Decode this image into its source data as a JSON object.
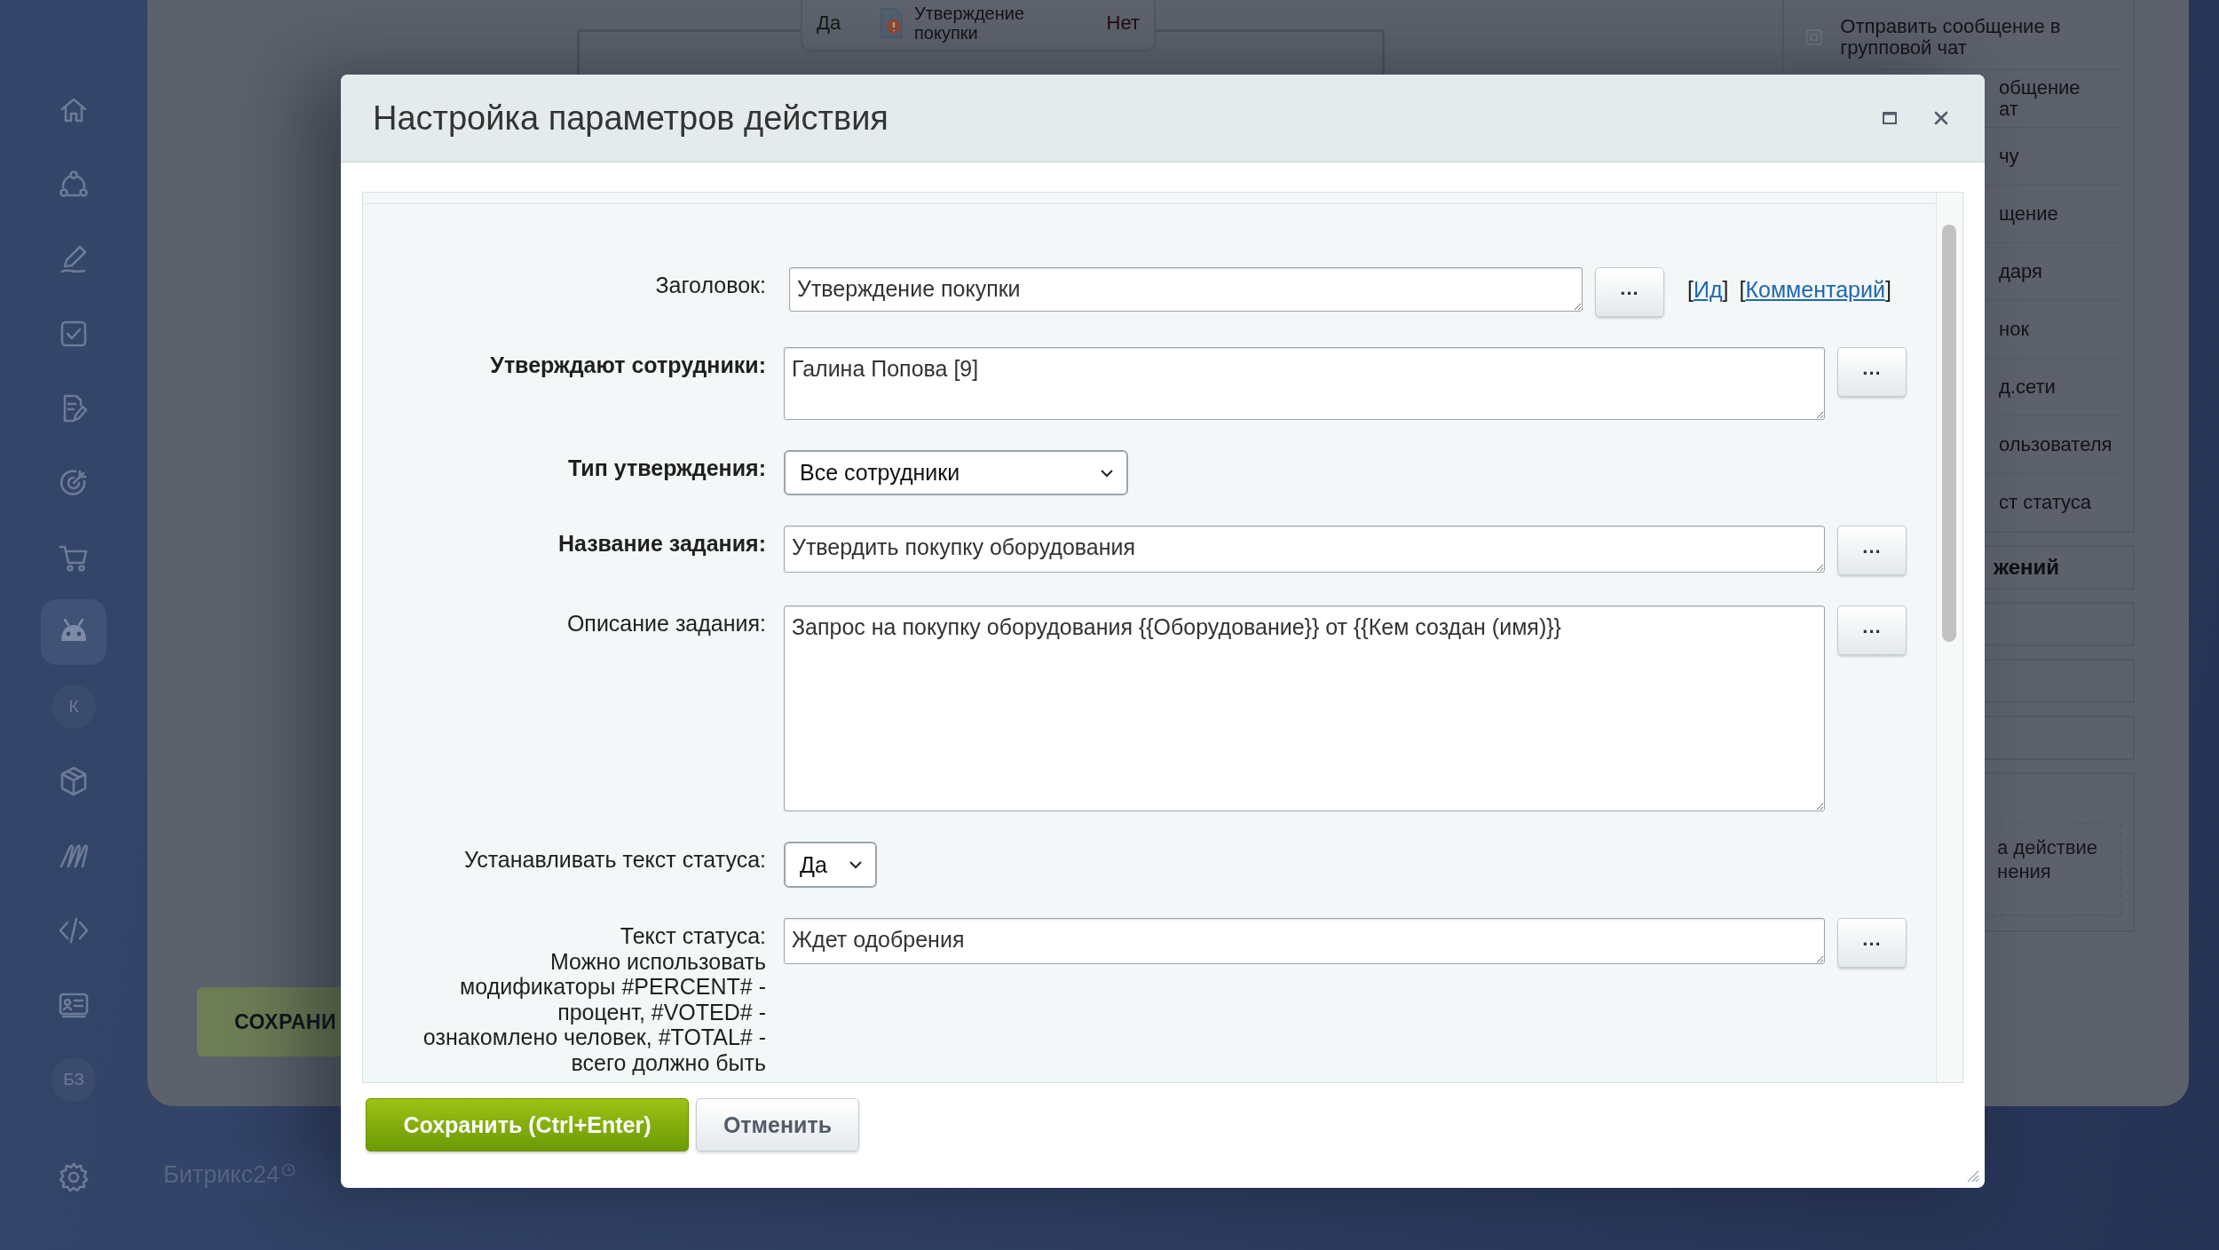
{
  "sidebar": {
    "items": [
      {
        "kind": "icon",
        "selected": false
      },
      {
        "kind": "icon",
        "selected": false
      },
      {
        "kind": "icon",
        "selected": false
      },
      {
        "kind": "icon",
        "selected": false
      },
      {
        "kind": "icon",
        "selected": false
      },
      {
        "kind": "icon",
        "selected": false
      },
      {
        "kind": "icon",
        "selected": false
      },
      {
        "kind": "icon",
        "selected": true
      },
      {
        "kind": "avatar",
        "label": "К",
        "selected": false
      },
      {
        "kind": "icon",
        "selected": false
      },
      {
        "kind": "icon",
        "selected": false
      },
      {
        "kind": "icon",
        "selected": false
      },
      {
        "kind": "icon",
        "selected": false
      },
      {
        "kind": "avatar",
        "label": "БЗ",
        "selected": false
      },
      {
        "kind": "icon",
        "selected": false
      }
    ]
  },
  "background": {
    "diagram": {
      "yes_label": "Да",
      "title": "Утверждение покупки",
      "no_label": "Нет"
    },
    "actions_panel": {
      "items": [
        {
          "kind": "action",
          "label": "Отправить сообщение в групповой чат"
        },
        {
          "kind": "fragment",
          "label": "общение\nат"
        },
        {
          "kind": "fragment",
          "label": "чу"
        },
        {
          "kind": "fragment",
          "label": "щение"
        },
        {
          "kind": "fragment",
          "label": "даря"
        },
        {
          "kind": "fragment",
          "label": "нок"
        },
        {
          "kind": "fragment",
          "label": "д.сети"
        },
        {
          "kind": "fragment",
          "label": "ользователя"
        },
        {
          "kind": "fragment",
          "label": "ст статуса"
        }
      ],
      "group_title": "жений",
      "drop_hint": "а действие\nнения"
    },
    "save_button": "СОХРАНИ",
    "brand": "Битрикс24"
  },
  "dialog": {
    "title": "Настройка параметров действия",
    "fields": [
      {
        "kind": "input",
        "label": "Заголовок:",
        "required": false,
        "value": "Утверждение покупки",
        "button": "...",
        "links": [
          {
            "open": "[",
            "label": "Ид",
            "close": "]"
          },
          {
            "open": "[",
            "label": "Комментарий",
            "close": "]"
          }
        ]
      },
      {
        "kind": "textarea",
        "label": "Утверждают сотрудники:",
        "required": true,
        "value": "Галина Попова [9]",
        "button": "...",
        "tall": false
      },
      {
        "kind": "select",
        "label": "Тип утверждения:",
        "required": true,
        "value": "Все сотрудники",
        "narrow": false
      },
      {
        "kind": "textarea",
        "label": "Название задания:",
        "required": true,
        "value": "Утвердить покупку оборудования",
        "button": "...",
        "tall": false
      },
      {
        "kind": "textarea",
        "label": "Описание задания:",
        "required": false,
        "value": "Запрос на покупку оборудования {{Оборудование}} от {{Кем создан (имя)}}",
        "button": "...",
        "tall": true
      },
      {
        "kind": "select",
        "label": "Устанавливать текст статуса:",
        "required": false,
        "value": "Да",
        "narrow": true
      },
      {
        "kind": "input",
        "label": "Текст статуса:",
        "hint": "Можно использовать модификаторы #PERCENT# - процент, #VOTED# - ознакомлено человек, #TOTAL# - всего должно быть",
        "required": false,
        "value": "Ждет одобрения",
        "button": "..."
      }
    ],
    "buttons": [
      {
        "kind": "primary",
        "label": "Сохранить (Ctrl+Enter)"
      },
      {
        "kind": "secondary",
        "label": "Отменить"
      }
    ]
  }
}
